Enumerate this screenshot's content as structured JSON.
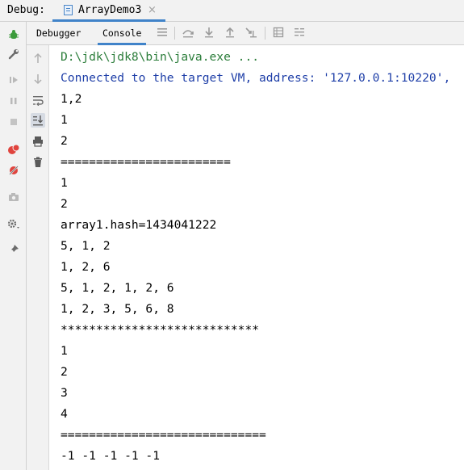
{
  "title_bar": {
    "label": "Debug:",
    "tab": {
      "label": "ArrayDemo3",
      "close": "×"
    }
  },
  "subtabs": {
    "debugger": "Debugger",
    "console": "Console"
  },
  "left_toolbar": {
    "icons": [
      "bug-icon",
      "wrench-icon",
      "resume-icon",
      "pause-icon",
      "stop-icon",
      "view-breakpoints-icon",
      "mute-breakpoints-icon",
      "camera-icon",
      "settings-icon",
      "pin-icon"
    ]
  },
  "subbar_icons": [
    "menu-icon",
    "step-over-icon",
    "step-into-icon",
    "step-out-icon",
    "run-to-cursor-icon",
    "evaluate-icon",
    "frames-icon"
  ],
  "console_toolbar": {
    "icons": [
      "up-arrow-icon",
      "down-arrow-icon",
      "soft-wrap-icon",
      "scroll-to-end-icon",
      "print-icon",
      "trash-icon"
    ]
  },
  "console": {
    "lines": [
      "D:\\jdk\\jdk8\\bin\\java.exe ...",
      "Connected to the target VM, address: '127.0.0.1:10220',",
      "1,2",
      "1",
      "2",
      "========================",
      "1",
      "2",
      "array1.hash=1434041222",
      "5, 1, 2",
      "1, 2, 6",
      "5, 1, 2, 1, 2, 6",
      "1, 2, 3, 5, 6, 8",
      "****************************",
      "1",
      "2",
      "3",
      "4",
      "=============================",
      "-1 -1 -1 -1 -1"
    ]
  },
  "colors": {
    "command_text": "#2b7d3a",
    "info_text": "#1f3fa8",
    "accent": "#4083c9"
  }
}
